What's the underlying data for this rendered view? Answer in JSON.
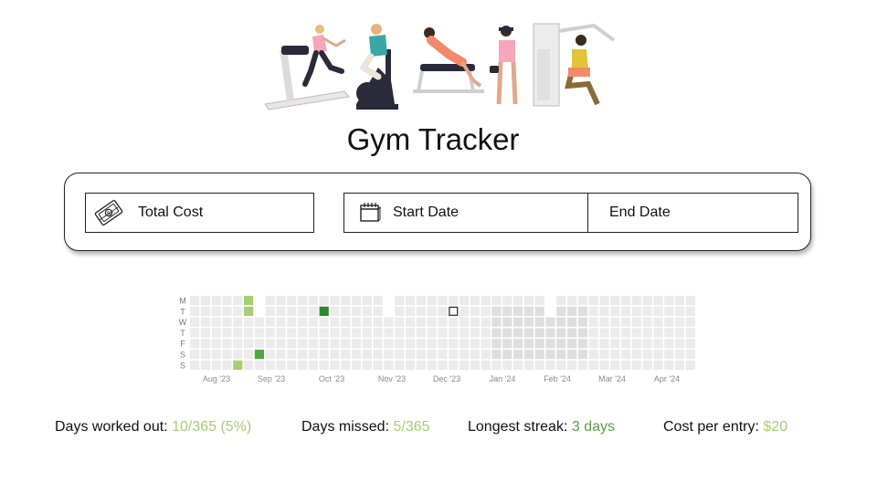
{
  "app": {
    "title": "Gym Tracker"
  },
  "inputs": {
    "total_cost": {
      "placeholder": "Total Cost",
      "icon": "money-icon"
    },
    "start_date": {
      "placeholder": "Start Date",
      "icon": "calendar-icon"
    },
    "end_date": {
      "placeholder": "End Date"
    }
  },
  "heatmap": {
    "day_labels": [
      "M",
      "T",
      "W",
      "T",
      "F",
      "S",
      "S"
    ],
    "month_labels": [
      "Aug '23",
      "Sep '23",
      "Oct '23",
      "Nov '23",
      "Dec '23",
      "Jan '24",
      "Feb '24",
      "Mar '24",
      "Apr '24"
    ],
    "colors": {
      "empty": "#ebebeb",
      "empty_dark": "#dedede",
      "light": "#a7cf73",
      "mid": "#53a541",
      "dark": "#2b8a2b",
      "today_border": "#222222"
    }
  },
  "stats": {
    "days_worked_out": {
      "label": "Days worked out:",
      "value": "10/365 (5%)"
    },
    "days_missed": {
      "label": "Days missed:",
      "value": "5/365"
    },
    "longest_streak": {
      "label": "Longest streak:",
      "value": "3 days"
    },
    "cost_per_entry": {
      "label": "Cost per entry:",
      "value": "$20"
    }
  }
}
